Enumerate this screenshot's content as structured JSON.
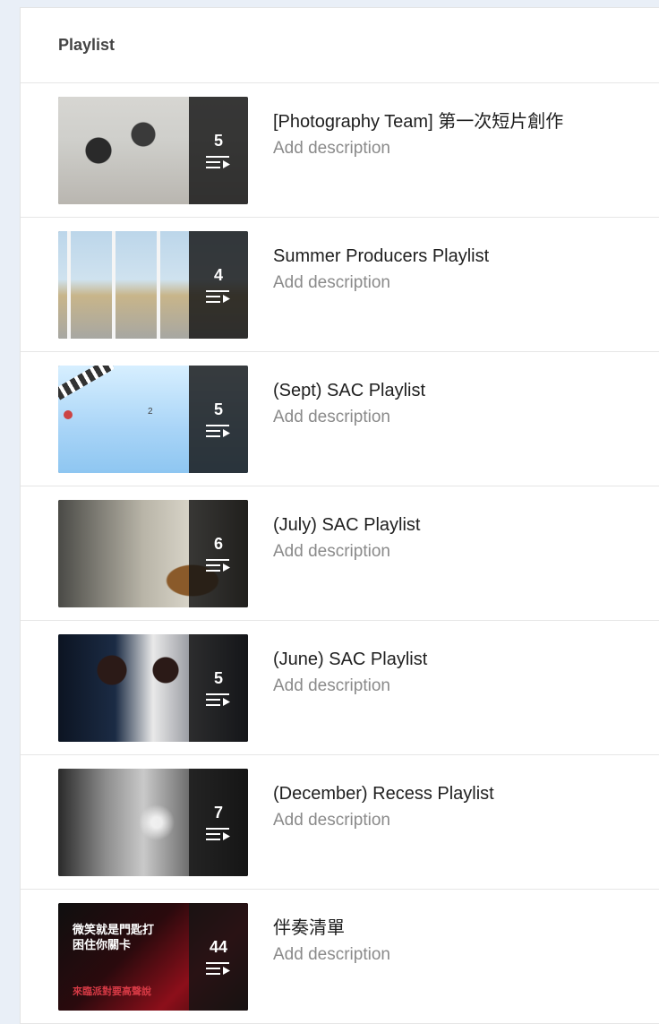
{
  "header": {
    "title": "Playlist"
  },
  "add_description": "Add description",
  "playlists": [
    {
      "title": "[Photography Team] 第一次短片創作",
      "count": "5"
    },
    {
      "title": "Summer Producers Playlist",
      "count": "4"
    },
    {
      "title": "(Sept) SAC Playlist",
      "count": "5"
    },
    {
      "title": "(July) SAC Playlist",
      "count": "6"
    },
    {
      "title": "(June) SAC Playlist",
      "count": "5"
    },
    {
      "title": "(December) Recess Playlist",
      "count": "7"
    },
    {
      "title": "伴奏清單",
      "count": "44"
    }
  ],
  "thumb_text": {
    "sept_number": "2",
    "banwou_line1": "微笑就是門匙打",
    "banwou_line2": "困住你關卡",
    "banwou_line3": "來臨派對要高聲說"
  },
  "icons": {
    "playlist": "playlist-play-icon"
  }
}
